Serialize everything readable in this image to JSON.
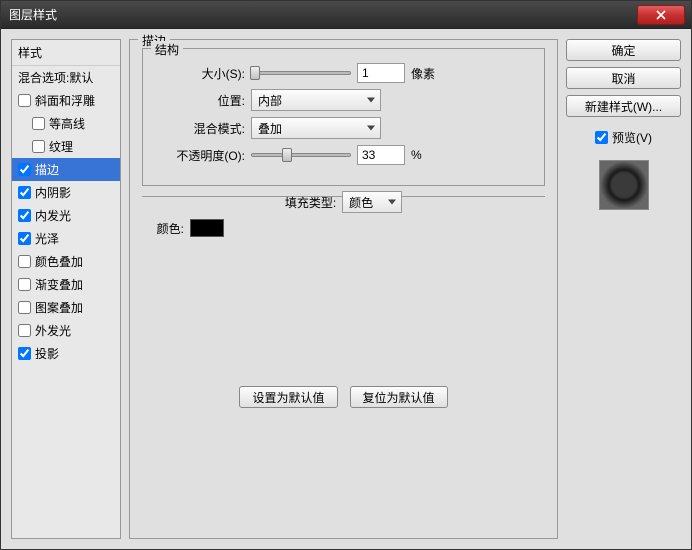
{
  "window": {
    "title": "图层样式"
  },
  "sidebar": {
    "header": "样式",
    "blend_options": "混合选项:默认",
    "items": [
      {
        "label": "斜面和浮雕",
        "checked": false,
        "indent": false
      },
      {
        "label": "等高线",
        "checked": false,
        "indent": true
      },
      {
        "label": "纹理",
        "checked": false,
        "indent": true
      },
      {
        "label": "描边",
        "checked": true,
        "indent": false,
        "selected": true
      },
      {
        "label": "内阴影",
        "checked": true,
        "indent": false
      },
      {
        "label": "内发光",
        "checked": true,
        "indent": false
      },
      {
        "label": "光泽",
        "checked": true,
        "indent": false
      },
      {
        "label": "颜色叠加",
        "checked": false,
        "indent": false
      },
      {
        "label": "渐变叠加",
        "checked": false,
        "indent": false
      },
      {
        "label": "图案叠加",
        "checked": false,
        "indent": false
      },
      {
        "label": "外发光",
        "checked": false,
        "indent": false
      },
      {
        "label": "投影",
        "checked": true,
        "indent": false
      }
    ]
  },
  "main": {
    "group_title": "描边",
    "structure_title": "结构",
    "size_label": "大小(S):",
    "size_value": "1",
    "size_unit": "像素",
    "position_label": "位置:",
    "position_value": "内部",
    "blend_mode_label": "混合模式:",
    "blend_mode_value": "叠加",
    "opacity_label": "不透明度(O):",
    "opacity_value": "33",
    "opacity_unit": "%",
    "fill_type_label": "填充类型:",
    "fill_type_value": "颜色",
    "color_label": "颜色:",
    "color_value": "#000000",
    "set_default": "设置为默认值",
    "reset_default": "复位为默认值"
  },
  "right": {
    "ok": "确定",
    "cancel": "取消",
    "new_style": "新建样式(W)...",
    "preview_label": "预览(V)",
    "preview_checked": true
  }
}
